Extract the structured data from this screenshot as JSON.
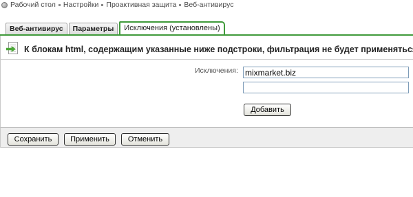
{
  "breadcrumb": {
    "items": [
      "Рабочий стол",
      "Настройки",
      "Проактивная защита",
      "Веб-антивирус"
    ]
  },
  "tabs": [
    {
      "label": "Веб-антивирус",
      "active": false
    },
    {
      "label": "Параметры",
      "active": false
    },
    {
      "label": "Исключения (установлены)",
      "active": true
    }
  ],
  "notice": {
    "text": "К блокам html, содержащим указанные ниже подстроки, фильтрация не будет применяться."
  },
  "form": {
    "exclusions_label": "Исключения:",
    "inputs": [
      {
        "value": "mixmarket.biz",
        "placeholder": ""
      },
      {
        "value": "",
        "placeholder": ""
      }
    ],
    "add_button": "Добавить"
  },
  "footer": {
    "save": "Сохранить",
    "apply": "Применить",
    "cancel": "Отменить"
  },
  "colors": {
    "accent": "#3f9a3a",
    "input_border": "#7f9db9",
    "footer_bg": "#eeeeee"
  },
  "icons": {
    "home": "desktop-icon",
    "notice": "document-arrow-icon"
  }
}
